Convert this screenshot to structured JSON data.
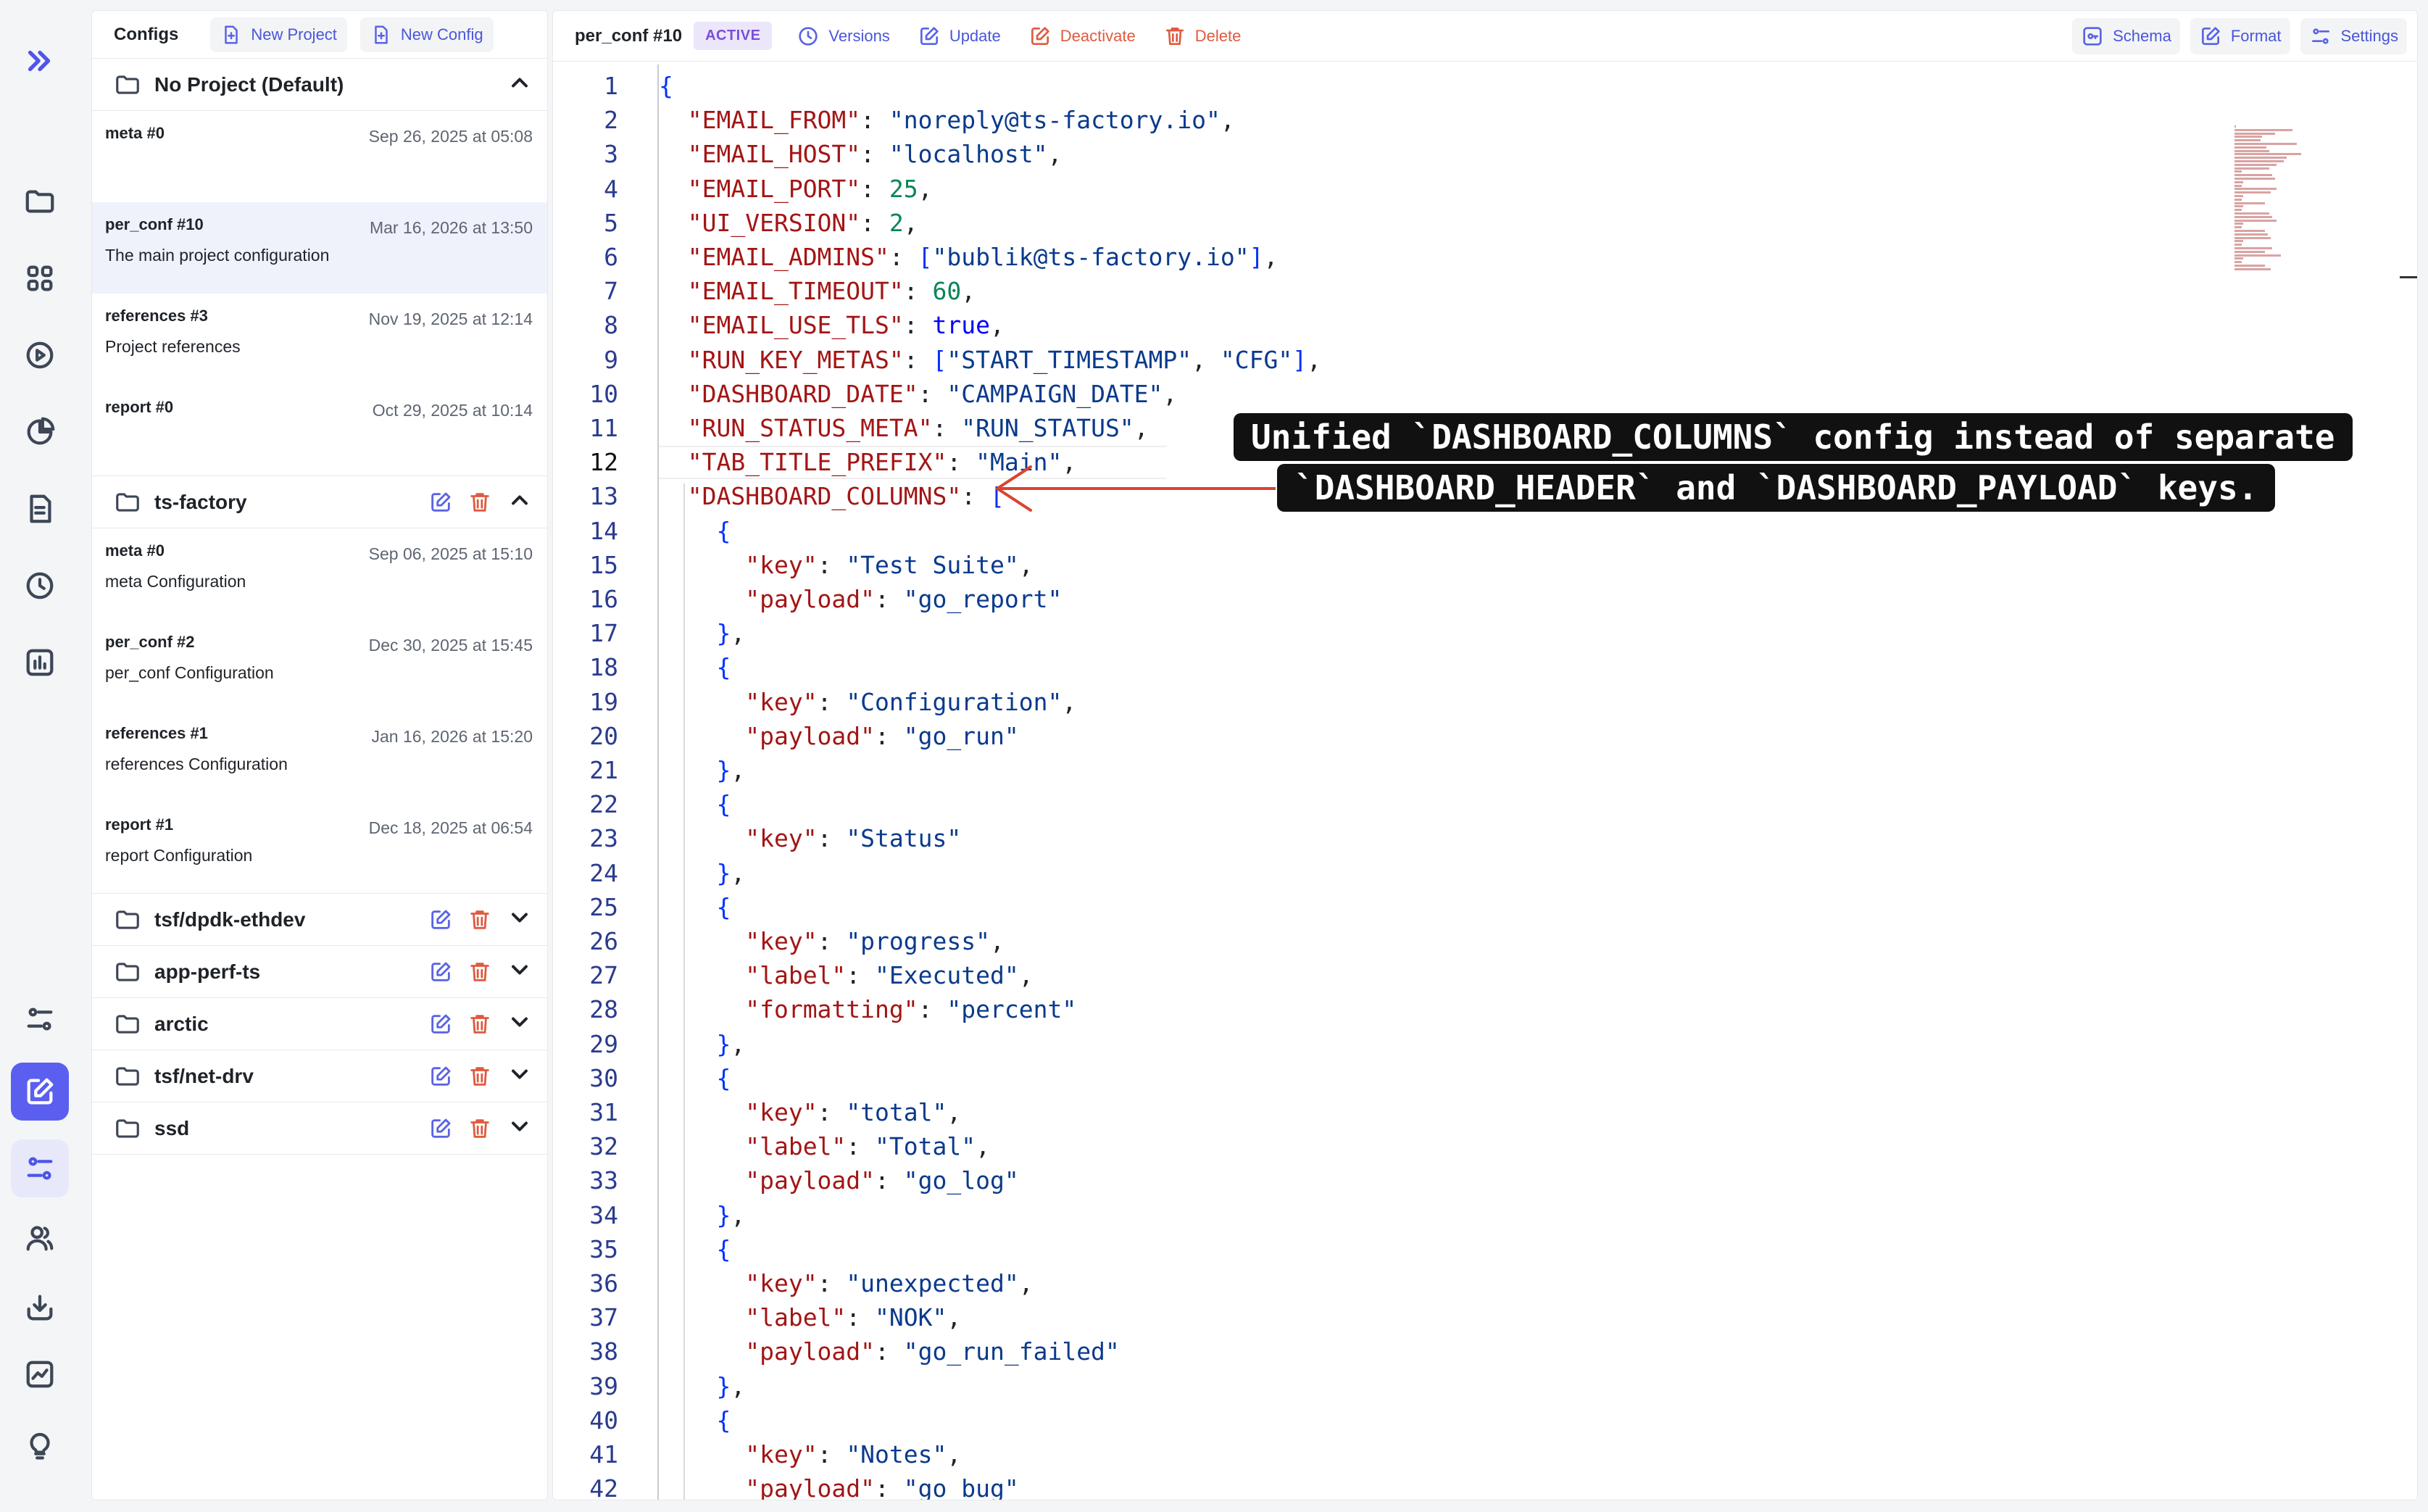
{
  "panel": {
    "title": "Configs",
    "new_project": "New Project",
    "new_config": "New Config"
  },
  "groups": [
    {
      "name": "No Project (Default)",
      "items": [
        {
          "name": "meta #0",
          "date": "Sep 26, 2025 at 05:08",
          "desc": ""
        },
        {
          "name": "per_conf #10",
          "date": "Mar 16, 2026 at 13:50",
          "desc": "The main project configuration"
        },
        {
          "name": "references #3",
          "date": "Nov 19, 2025 at 12:14",
          "desc": "Project references"
        },
        {
          "name": "report #0",
          "date": "Oct 29, 2025 at 10:14",
          "desc": ""
        }
      ]
    },
    {
      "name": "ts-factory",
      "items": [
        {
          "name": "meta #0",
          "date": "Sep 06, 2025 at 15:10",
          "desc": "meta Configuration"
        },
        {
          "name": "per_conf #2",
          "date": "Dec 30, 2025 at 15:45",
          "desc": "per_conf Configuration"
        },
        {
          "name": "references #1",
          "date": "Jan 16, 2026 at 15:20",
          "desc": "references Configuration"
        },
        {
          "name": "report #1",
          "date": "Dec 18, 2025 at 06:54",
          "desc": "report Configuration"
        }
      ]
    },
    {
      "name": "tsf/dpdk-ethdev"
    },
    {
      "name": "app-perf-ts"
    },
    {
      "name": "arctic"
    },
    {
      "name": "tsf/net-drv"
    },
    {
      "name": "ssd"
    }
  ],
  "editor": {
    "title": "per_conf #10",
    "status": "ACTIVE",
    "versions": "Versions",
    "update": "Update",
    "deactivate": "Deactivate",
    "delete": "Delete",
    "schema": "Schema",
    "format": "Format",
    "settings": "Settings",
    "current_line": 12,
    "lines": [
      "{",
      "  \"EMAIL_FROM\": \"noreply@ts-factory.io\",",
      "  \"EMAIL_HOST\": \"localhost\",",
      "  \"EMAIL_PORT\": 25,",
      "  \"UI_VERSION\": 2,",
      "  \"EMAIL_ADMINS\": [\"bublik@ts-factory.io\"],",
      "  \"EMAIL_TIMEOUT\": 60,",
      "  \"EMAIL_USE_TLS\": true,",
      "  \"RUN_KEY_METAS\": [\"START_TIMESTAMP\", \"CFG\"],",
      "  \"DASHBOARD_DATE\": \"CAMPAIGN_DATE\",",
      "  \"RUN_STATUS_META\": \"RUN_STATUS\",",
      "  \"TAB_TITLE_PREFIX\": \"Main\",",
      "  \"DASHBOARD_COLUMNS\": [",
      "    {",
      "      \"key\": \"Test Suite\",",
      "      \"payload\": \"go_report\"",
      "    },",
      "    {",
      "      \"key\": \"Configuration\",",
      "      \"payload\": \"go_run\"",
      "    },",
      "    {",
      "      \"key\": \"Status\"",
      "    },",
      "    {",
      "      \"key\": \"progress\",",
      "      \"label\": \"Executed\",",
      "      \"formatting\": \"percent\"",
      "    },",
      "    {",
      "      \"key\": \"total\",",
      "      \"label\": \"Total\",",
      "      \"payload\": \"go_log\"",
      "    },",
      "    {",
      "      \"key\": \"unexpected\",",
      "      \"label\": \"NOK\",",
      "      \"payload\": \"go_run_failed\"",
      "    },",
      "    {",
      "      \"key\": \"Notes\",",
      "      \"payload\": \"go_bug\""
    ]
  },
  "annotation": {
    "line1": "Unified `DASHBOARD_COLUMNS` config instead of separate",
    "line2": "`DASHBOARD_HEADER` and `DASHBOARD_PAYLOAD` keys."
  },
  "icons": {
    "rail": [
      "expand-icon",
      "folder-icon",
      "grid-icon",
      "play-icon",
      "pie-chart-icon",
      "document-icon",
      "history-icon",
      "bar-chart-icon",
      "sliders-icon",
      "edit-icon",
      "sliders-alt-icon",
      "users-icon",
      "import-icon",
      "trend-icon",
      "lightbulb-icon"
    ]
  },
  "colors": {
    "accent": "#5a5ff0",
    "danger": "#e05a3f",
    "badge_bg": "#ece6fb",
    "badge_text": "#7a4fd6",
    "json_key": "#a31515",
    "json_string": "#0a3a8c",
    "json_number": "#098658",
    "json_bool": "#0000ff"
  }
}
